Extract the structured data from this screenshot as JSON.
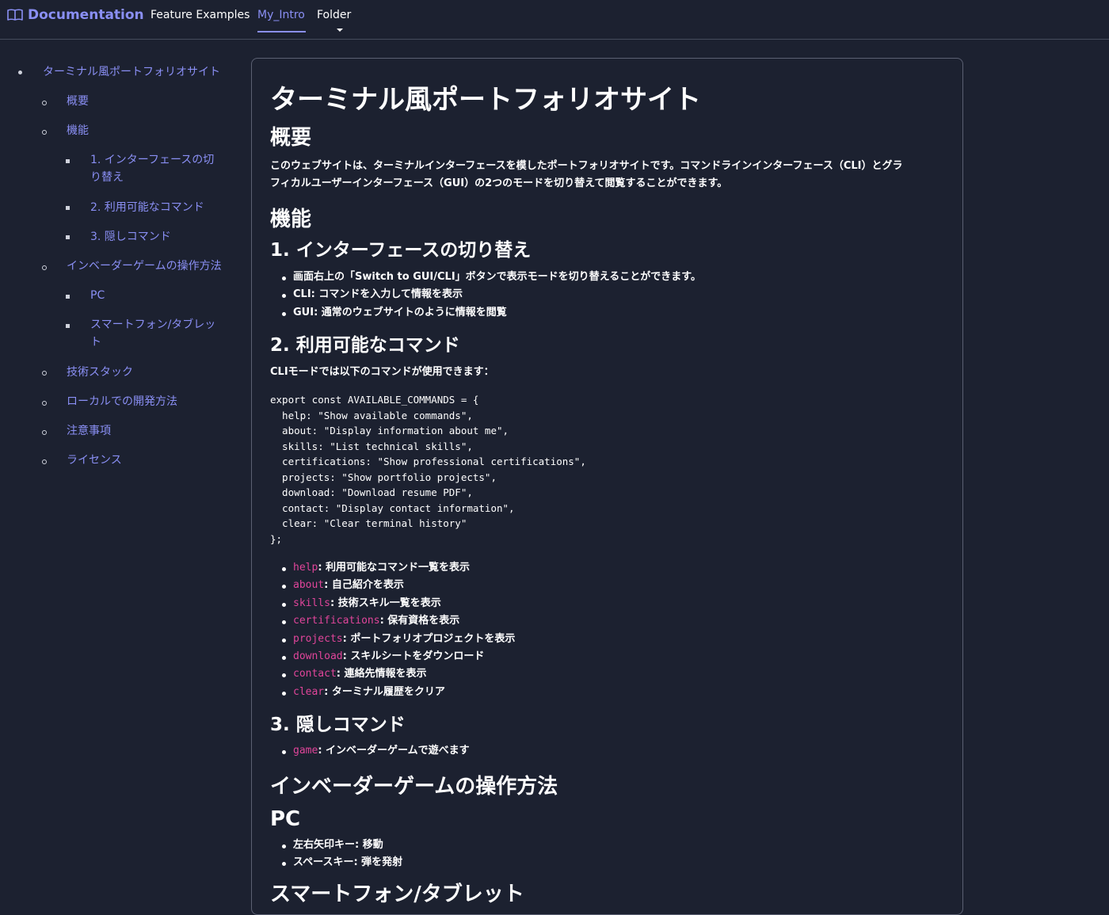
{
  "header": {
    "brand": "Documentation",
    "brand_icon": "book-icon",
    "nav": [
      {
        "label": "Feature Examples",
        "active": false
      },
      {
        "label": "My_Intro",
        "active": true
      },
      {
        "label": "Folder",
        "active": false
      }
    ]
  },
  "sidebar": {
    "items": [
      {
        "label": "ターミナル風ポートフォリオサイト",
        "level": 1
      },
      {
        "label": "概要",
        "level": 2
      },
      {
        "label": "機能",
        "level": 2
      },
      {
        "label_lines": [
          "1. インターフェースの切",
          "り替え"
        ],
        "level": 3
      },
      {
        "label": "2. 利用可能なコマンド",
        "level": 3
      },
      {
        "label": "3. 隠しコマンド",
        "level": 3
      },
      {
        "label": "インベーダーゲームの操作方法",
        "level": 2
      },
      {
        "label": "PC",
        "level": 3
      },
      {
        "label_lines": [
          "スマートフォン/タブレッ",
          "ト"
        ],
        "level": 3
      },
      {
        "label": "技術スタック",
        "level": 2
      },
      {
        "label": "ローカルでの開発方法",
        "level": 2
      },
      {
        "label": "注意事項",
        "level": 2
      },
      {
        "label": "ライセンス",
        "level": 2
      }
    ]
  },
  "content": {
    "title": "ターミナル風ポートフォリオサイト",
    "overview_heading": "概要",
    "overview_lines": [
      "このウェブサイトは、ターミナルインターフェースを模したポートフォリオサイトです。コマンドラインインターフェース（CLI）とグラ",
      "フィカルユーザーインターフェース（GUI）の2つのモードを切り替えて閲覧することができます。"
    ],
    "features_heading": "機能",
    "switch_heading": "1. インターフェースの切り替え",
    "switch_items": [
      "画面右上の「Switch to GUI/CLI」ボタンで表示モードを切り替えることができます。",
      "CLI: コマンドを入力して情報を表示",
      "GUI: 通常のウェブサイトのように情報を閲覧"
    ],
    "commands_heading": "2. 利用可能なコマンド",
    "commands_intro": "CLIモードでは以下のコマンドが使用できます：",
    "code": "export const AVAILABLE_COMMANDS = {\n  help: \"Show available commands\",\n  about: \"Display information about me\",\n  skills: \"List technical skills\",\n  certifications: \"Show professional certifications\",\n  projects: \"Show portfolio projects\",\n  download: \"Download resume PDF\",\n  contact: \"Display contact information\",\n  clear: \"Clear terminal history\"\n};",
    "commands": [
      {
        "cmd": "help",
        "desc": ": 利用可能なコマンド一覧を表示"
      },
      {
        "cmd": "about",
        "desc": ": 自己紹介を表示"
      },
      {
        "cmd": "skills",
        "desc": ": 技術スキル一覧を表示"
      },
      {
        "cmd": "certifications",
        "desc": ": 保有資格を表示"
      },
      {
        "cmd": "projects",
        "desc": ": ポートフォリオプロジェクトを表示"
      },
      {
        "cmd": "download",
        "desc": ": スキルシートをダウンロード"
      },
      {
        "cmd": "contact",
        "desc": ": 連絡先情報を表示"
      },
      {
        "cmd": "clear",
        "desc": ": ターミナル履歴をクリア"
      }
    ],
    "hidden_heading": "3. 隠しコマンド",
    "hidden_commands": [
      {
        "cmd": "game",
        "desc": ": インベーダーゲームで遊べます"
      }
    ],
    "game_heading": "インベーダーゲームの操作方法",
    "pc_heading": "PC",
    "pc_items": [
      "左右矢印キー: 移動",
      "スペースキー: 弾を発射"
    ],
    "mobile_heading_partial": "スマートフォン/タブレット"
  }
}
